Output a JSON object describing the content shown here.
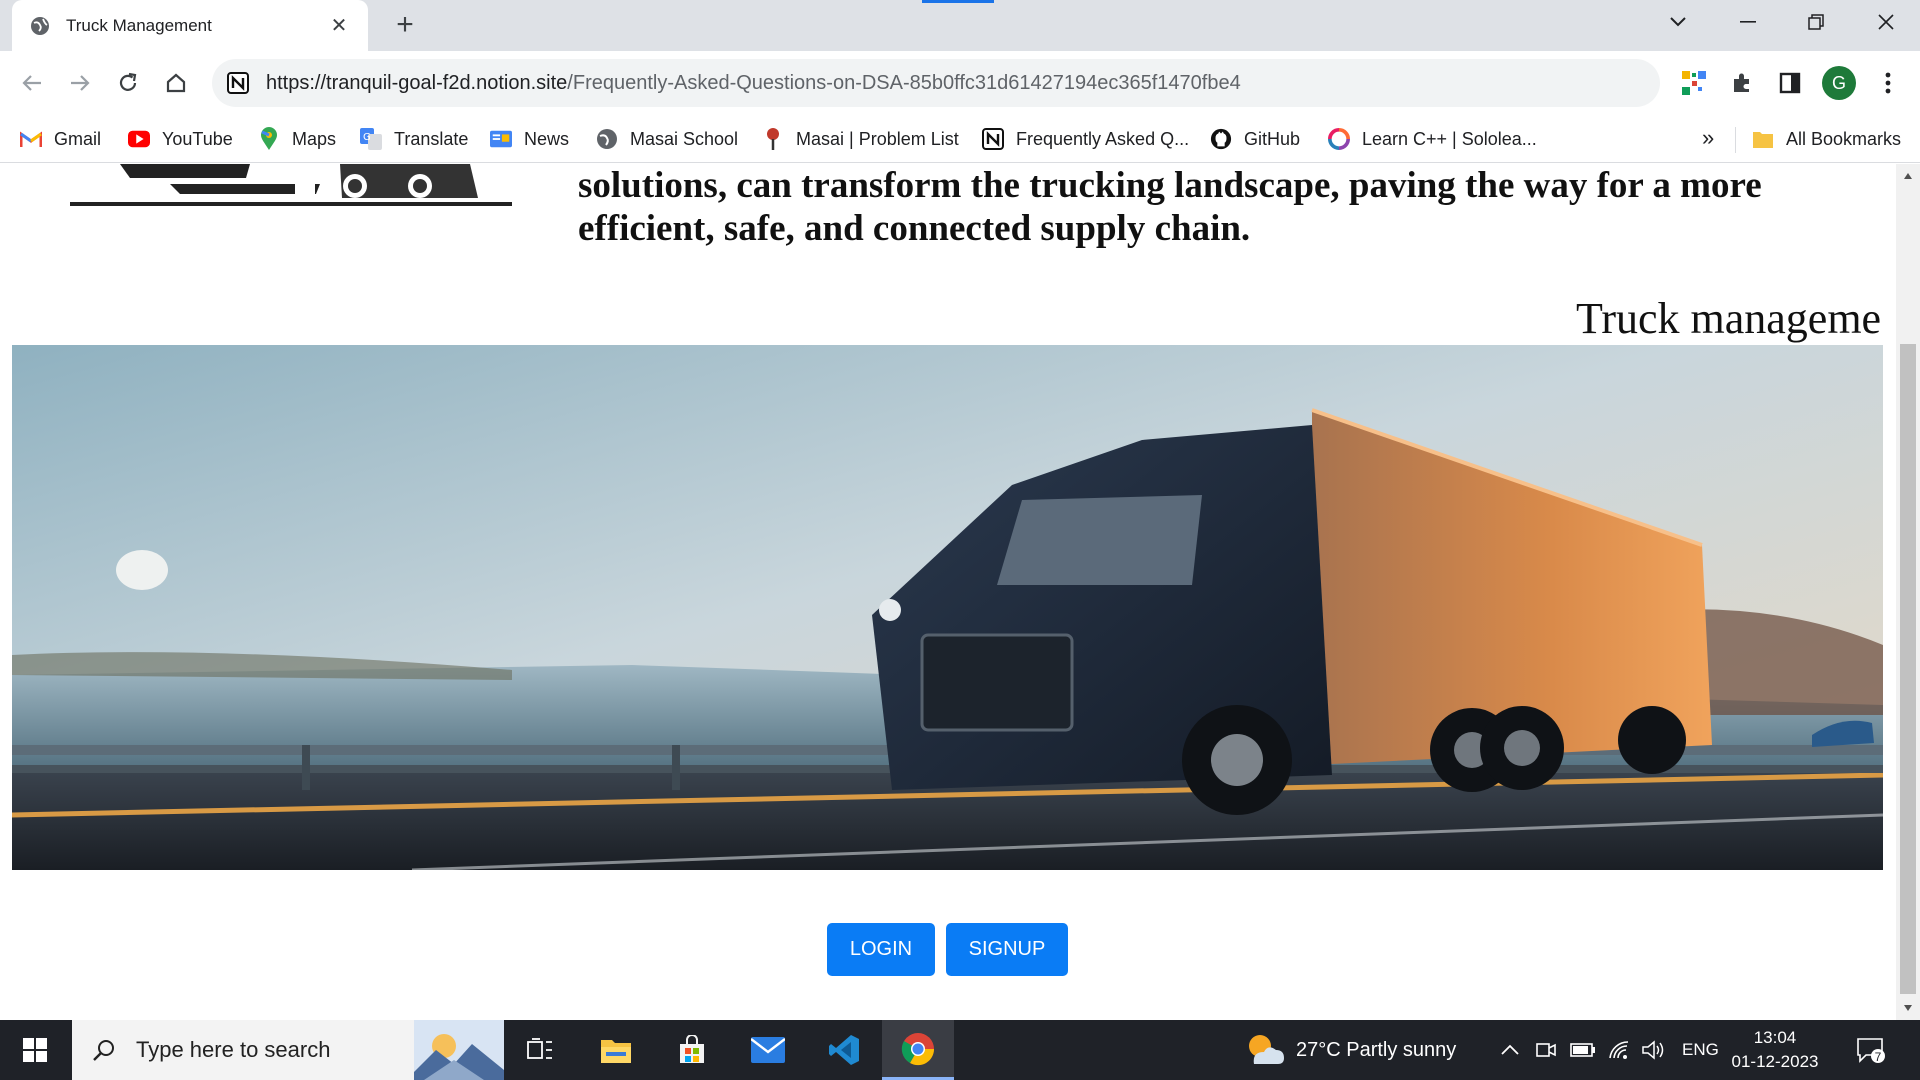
{
  "browser": {
    "tab_title": "Truck Management",
    "url_host": "https://tranquil-goal-f2d.notion.site",
    "url_path": "/Frequently-Asked-Questions-on-DSA-85b0ffc31d61427194ec365f1470fbe4",
    "profile_initial": "G"
  },
  "bookmarks": [
    {
      "label": "Gmail",
      "icon": "gmail-icon"
    },
    {
      "label": "YouTube",
      "icon": "youtube-icon"
    },
    {
      "label": "Maps",
      "icon": "maps-icon"
    },
    {
      "label": "Translate",
      "icon": "translate-icon"
    },
    {
      "label": "News",
      "icon": "news-icon"
    },
    {
      "label": "Masai School",
      "icon": "globe-icon"
    },
    {
      "label": "Masai | Problem List",
      "icon": "masai-icon"
    },
    {
      "label": "Frequently Asked Q...",
      "icon": "notion-icon"
    },
    {
      "label": "GitHub",
      "icon": "github-icon"
    },
    {
      "label": "Learn C++ | Sololea...",
      "icon": "sololearn-icon"
    }
  ],
  "bookmarks_more": "»",
  "all_bookmarks": "All Bookmarks",
  "page": {
    "intro_line1": "solutions, can transform the trucking landscape, paving the way for a more",
    "intro_line2": "efficient, safe, and connected supply chain.",
    "marquee_text": "Truck manageme",
    "login_label": "LOGIN",
    "signup_label": "SIGNUP"
  },
  "taskbar": {
    "search_placeholder": "Type here to search",
    "weather": "27°C  Partly sunny",
    "language": "ENG",
    "time": "13:04",
    "date": "01-12-2023",
    "notification_count": "7"
  },
  "colors": {
    "button_blue": "#0a7cf5",
    "taskbar_bg": "#1f2228",
    "accent": "#1a73e8"
  }
}
